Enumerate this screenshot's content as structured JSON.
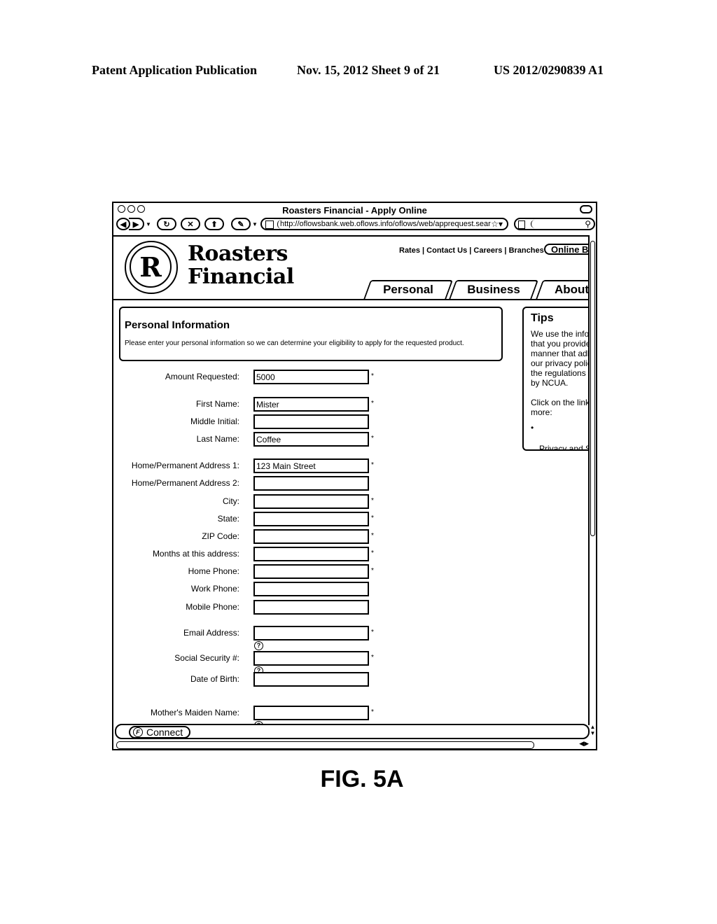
{
  "patent_header": {
    "left": "Patent Application Publication",
    "date_sheet": "Nov. 15, 2012   Sheet 9 of 21",
    "number": "US 2012/0290839 A1"
  },
  "browser": {
    "window_title": "Roasters Financial - Apply Online",
    "url": "http://oflowsbank.web.oflows.info/oflows/web/apprequest.sear",
    "search_value": "",
    "toolbar_icons": [
      "back-icon",
      "forward-icon",
      "reload-icon",
      "stop-icon",
      "home-icon",
      "edit-icon",
      "bookmark-star-icon",
      "search-icon"
    ]
  },
  "site": {
    "logo_letter": "R",
    "brand_line1": "Roasters",
    "brand_line2": "Financial",
    "top_links": "Rates | Contact Us | Careers | Branches",
    "online_banking": "Online Ba",
    "tabs": [
      "Personal",
      "Business",
      "About"
    ]
  },
  "info": {
    "title": "Personal Information",
    "text": "Please enter your personal information so we can determine your eligibility to apply for the requested product."
  },
  "tips": {
    "title": "Tips",
    "body": "We use the inform\nthat you provide u\nmanner that adhe\nour privacy policy\nthe regulations se\nby NCUA.\n\nClick on the link t\nmore:",
    "link": "Privacy and Se\nPolicies"
  },
  "form": {
    "required_mark": "*",
    "help_icon": "?",
    "fields": [
      {
        "label": "Amount Requested:",
        "value": "5000",
        "required": true
      },
      {
        "label": "First Name:",
        "value": "Mister",
        "required": true
      },
      {
        "label": "Middle Initial:",
        "value": "",
        "required": false
      },
      {
        "label": "Last Name:",
        "value": "Coffee",
        "required": true
      },
      {
        "label": "Home/Permanent Address 1:",
        "value": "123 Main Street",
        "required": true
      },
      {
        "label": "Home/Permanent Address 2:",
        "value": "",
        "required": false
      },
      {
        "label": "City:",
        "value": "",
        "required": true
      },
      {
        "label": "State:",
        "value": "",
        "required": true
      },
      {
        "label": "ZIP Code:",
        "value": "",
        "required": true
      },
      {
        "label": "Months at this address:",
        "value": "",
        "required": true
      },
      {
        "label": "Home Phone:",
        "value": "",
        "required": true
      },
      {
        "label": "Work Phone:",
        "value": "",
        "required": false
      },
      {
        "label": "Mobile Phone:",
        "value": "",
        "required": false
      },
      {
        "label": "Email Address:",
        "value": "",
        "required": true
      },
      {
        "label": "Social Security #:",
        "value": "",
        "required": true
      },
      {
        "label": "Date of Birth:",
        "value": "",
        "required": false
      },
      {
        "label": "Mother's Maiden Name:",
        "value": "",
        "required": true
      }
    ]
  },
  "status_bar": {
    "connect_label": "Connect"
  },
  "figure_caption": "FIG. 5A"
}
